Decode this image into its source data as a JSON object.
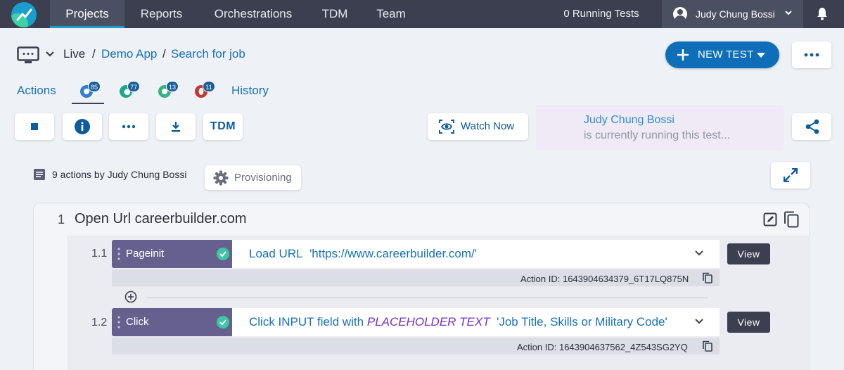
{
  "nav": {
    "tabs": [
      {
        "label": "Projects"
      },
      {
        "label": "Reports"
      },
      {
        "label": "Orchestrations"
      },
      {
        "label": "TDM"
      },
      {
        "label": "Team"
      }
    ],
    "active_tab": "Projects",
    "running_tests": "0 Running Tests",
    "user_name": "Judy Chung Bossi"
  },
  "header": {
    "environment": "Live",
    "breadcrumb": [
      {
        "label": "Demo App"
      },
      {
        "label": "Search for job"
      }
    ],
    "new_test_label": "NEW TEST"
  },
  "subtabs": {
    "actions_label": "Actions",
    "history_label": "History",
    "browsers": [
      {
        "name": "chrome-icon",
        "count": "85",
        "color": "#2f7fd0"
      },
      {
        "name": "edge-icon",
        "count": "77",
        "color": "#1fa58a"
      },
      {
        "name": "chrome-variant-icon",
        "count": "13",
        "color": "#35b37e"
      },
      {
        "name": "opera-icon",
        "count": "11",
        "color": "#c9342f"
      }
    ]
  },
  "toolbar": {
    "tdm_label": "TDM",
    "watch_now_label": "Watch Now",
    "running_user": "Judy Chung Bossi",
    "running_message": "is currently running this test..."
  },
  "summary": {
    "actions_text": "9 actions by Judy Chung Bossi",
    "provisioning_label": "Provisioning"
  },
  "step": {
    "number": "1",
    "title": "Open Url careerbuilder.com",
    "actions": [
      {
        "number": "1.1",
        "type": "Pageinit",
        "parts": [
          {
            "text": "Load URL",
            "style": "blue"
          },
          {
            "text": "'https://www.careerbuilder.com/'",
            "style": "blue"
          }
        ],
        "view_label": "View",
        "action_id": "Action ID: 1643904634379_6T17LQ875N"
      },
      {
        "number": "1.2",
        "type": "Click",
        "parts": [
          {
            "text": "Click INPUT  field with",
            "style": "blue"
          },
          {
            "text": "PLACEHOLDER TEXT",
            "style": "purple"
          },
          {
            "text": "'Job Title, Skills or Military Code'",
            "style": "blue"
          }
        ],
        "view_label": "View",
        "action_id": "Action ID: 1643904637562_4Z543SG2YQ"
      }
    ]
  }
}
